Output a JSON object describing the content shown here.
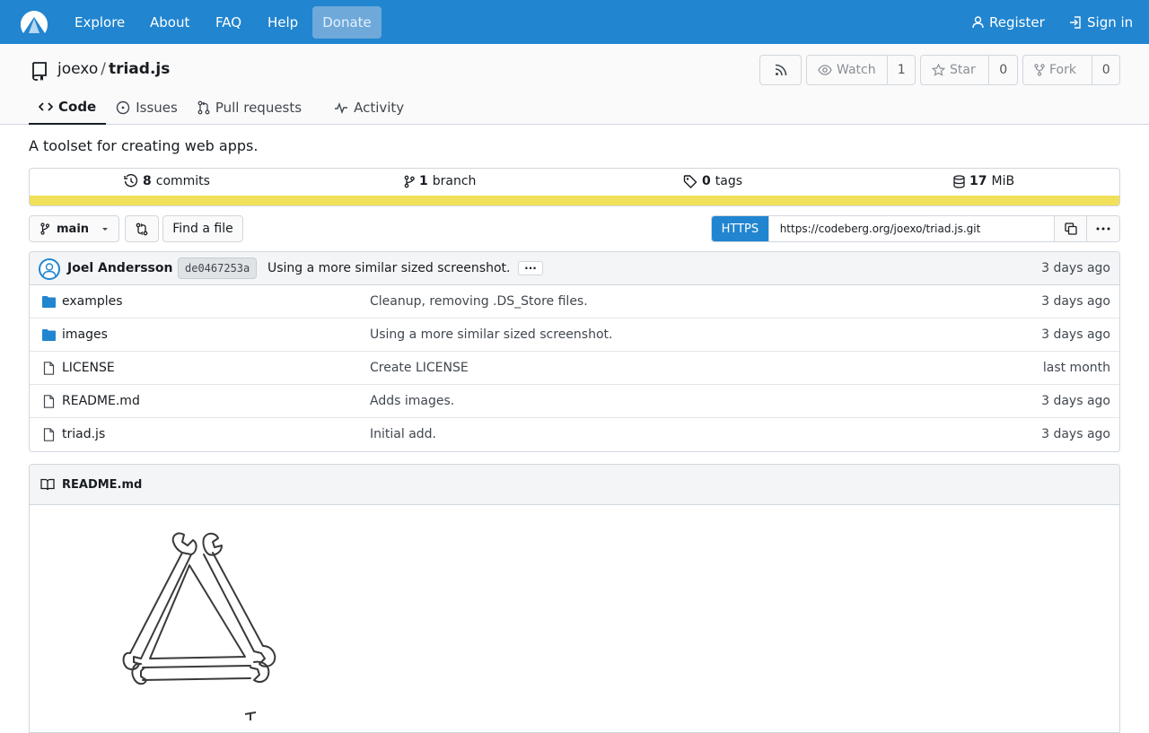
{
  "navbar": {
    "links": [
      "Explore",
      "About",
      "FAQ",
      "Help"
    ],
    "donate": "Donate",
    "register": "Register",
    "sign_in": "Sign in"
  },
  "repo": {
    "owner": "joexo",
    "separator": "/",
    "name": "triad.js",
    "watch_label": "Watch",
    "watch_count": "1",
    "star_label": "Star",
    "star_count": "0",
    "fork_label": "Fork",
    "fork_count": "0",
    "description": "A toolset for creating web apps."
  },
  "tabs": [
    {
      "label": "Code",
      "icon": "code-icon"
    },
    {
      "label": "Issues",
      "icon": "issue-icon"
    },
    {
      "label": "Pull requests",
      "icon": "pull-request-icon"
    },
    {
      "label": "Activity",
      "icon": "pulse-icon"
    }
  ],
  "stats": {
    "commits_count": "8",
    "commits_label": "commits",
    "branch_count": "1",
    "branch_label": "branch",
    "tags_count": "0",
    "tags_label": "tags",
    "size_count": "17",
    "size_unit": "MiB",
    "language_color": "#f1e05a"
  },
  "toolbar": {
    "branch": "main",
    "find_file": "Find a file",
    "protocol": "HTTPS",
    "clone_url": "https://codeberg.org/joexo/triad.js.git"
  },
  "latest_commit": {
    "author": "Joel Andersson",
    "sha": "de0467253a",
    "message": "Using a more similar sized screenshot.",
    "ellipsis": "···",
    "time": "3 days ago"
  },
  "files": [
    {
      "type": "folder",
      "name": "examples",
      "message": "Cleanup, removing .DS_Store files.",
      "time": "3 days ago"
    },
    {
      "type": "folder",
      "name": "images",
      "message": "Using a more similar sized screenshot.",
      "time": "3 days ago"
    },
    {
      "type": "file",
      "name": "LICENSE",
      "message": "Create LICENSE",
      "time": "last month"
    },
    {
      "type": "file",
      "name": "README.md",
      "message": "Adds images.",
      "time": "3 days ago"
    },
    {
      "type": "file",
      "name": "triad.js",
      "message": "Initial add.",
      "time": "3 days ago"
    }
  ],
  "readme": {
    "filename": "README.md"
  },
  "colors": {
    "brand": "#2185d0",
    "donate": "#6ea9da",
    "folder": "#2185d0"
  }
}
